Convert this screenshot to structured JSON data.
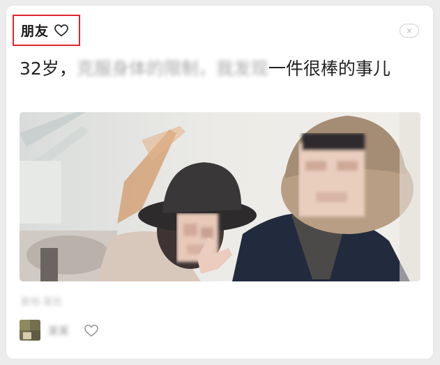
{
  "card": {
    "title": "朋友",
    "close_label": "×"
  },
  "post": {
    "text_before": "32岁，",
    "text_blur_1": "克服身体的限制，",
    "text_blur_2": "我发现",
    "text_after": "一件很棒的事儿"
  },
  "meta": {
    "location_blurred": "某地·某处"
  },
  "author": {
    "name_blurred": "某某"
  },
  "colors": {
    "highlight_border": "#e0252b",
    "text": "#222222",
    "card_bg": "#ffffff",
    "page_bg": "#ececec"
  },
  "icons": {
    "title_heart": "heart-outline-icon",
    "close": "close-icon",
    "like": "heart-outline-icon"
  }
}
